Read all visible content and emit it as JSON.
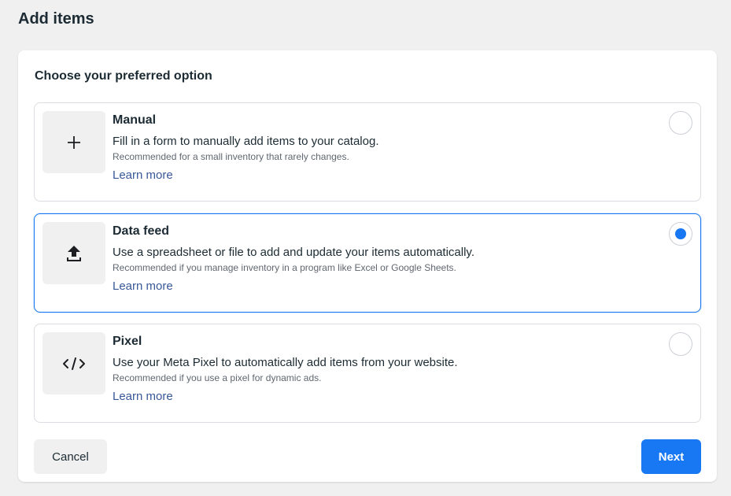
{
  "page": {
    "title": "Add items"
  },
  "card": {
    "heading": "Choose your preferred option",
    "options": [
      {
        "icon": "plus-icon",
        "title": "Manual",
        "description": "Fill in a form to manually add items to your catalog.",
        "subtext": "Recommended for a small inventory that rarely changes.",
        "link": "Learn more",
        "selected": false
      },
      {
        "icon": "upload-icon",
        "title": "Data feed",
        "description": "Use a spreadsheet or file to add and update your items automatically.",
        "subtext": "Recommended if you manage inventory in a program like Excel or Google Sheets.",
        "link": "Learn more",
        "selected": true
      },
      {
        "icon": "code-icon",
        "title": "Pixel",
        "description": "Use your Meta Pixel to automatically add items from your website.",
        "subtext": "Recommended if you use a pixel for dynamic ads.",
        "link": "Learn more",
        "selected": false
      }
    ]
  },
  "footer": {
    "cancel_label": "Cancel",
    "next_label": "Next"
  },
  "colors": {
    "accent": "#1877f2",
    "link": "#385898",
    "background": "#f0f0f0"
  }
}
